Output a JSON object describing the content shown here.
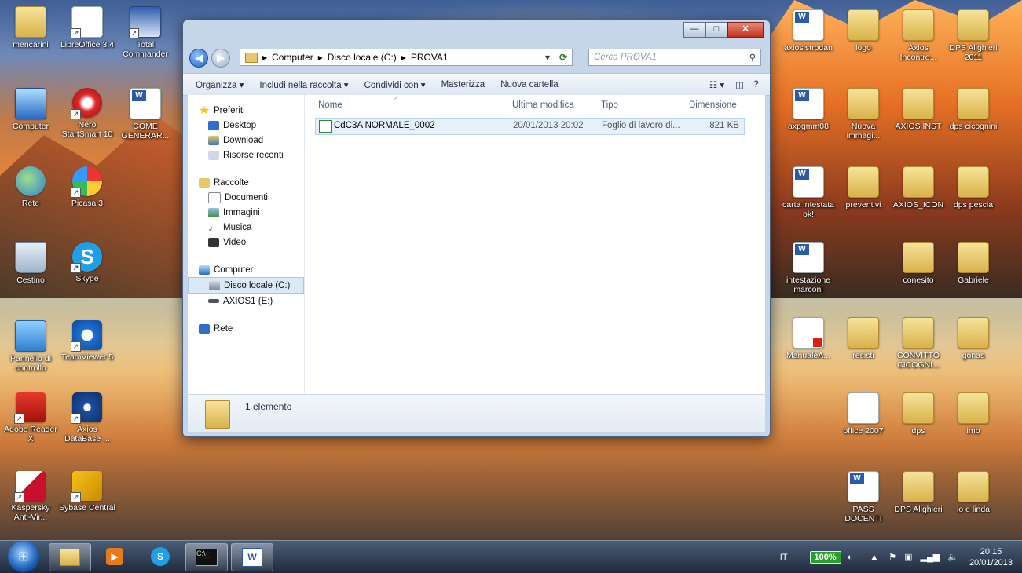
{
  "desktop": {
    "icons": [
      {
        "label": "mencarini"
      },
      {
        "label": "LibreOffice 3.4"
      },
      {
        "label": "Total Commander"
      },
      {
        "label": "Computer"
      },
      {
        "label": "Nero StartSmart 10"
      },
      {
        "label": "COME GENERAR..."
      },
      {
        "label": "Rete"
      },
      {
        "label": "Picasa 3"
      },
      {
        "label": "Cestino"
      },
      {
        "label": "Skype"
      },
      {
        "label": "Pannello di controllo"
      },
      {
        "label": "TeamViewer 5"
      },
      {
        "label": "Adobe Reader X"
      },
      {
        "label": "Axios DataBase ..."
      },
      {
        "label": "Kaspersky Anti-Vir..."
      },
      {
        "label": "Sybase Central"
      },
      {
        "label": "axiosistrodan"
      },
      {
        "label": "logo"
      },
      {
        "label": "Axios Incontro..."
      },
      {
        "label": "DPS Alighieri 2011"
      },
      {
        "label": "axpgmm08"
      },
      {
        "label": "Nuova immagi..."
      },
      {
        "label": "AXIOS INST"
      },
      {
        "label": "dps cicognini"
      },
      {
        "label": "carta intestata ok!"
      },
      {
        "label": "preventivi"
      },
      {
        "label": "AXIOS_ICON"
      },
      {
        "label": "dps pescia"
      },
      {
        "label": "intestazione marconi"
      },
      {
        "label": "conesito"
      },
      {
        "label": "Gabriele"
      },
      {
        "label": "ManualeA..."
      },
      {
        "label": "resisti"
      },
      {
        "label": "CONVITTO CICOGNI..."
      },
      {
        "label": "gonas"
      },
      {
        "label": "office 2007"
      },
      {
        "label": "dps"
      },
      {
        "label": "imb"
      },
      {
        "label": "PASS DOCENTI"
      },
      {
        "label": "DPS Alighieri"
      },
      {
        "label": "io e linda"
      }
    ]
  },
  "explorer": {
    "breadcrumb": [
      "Computer",
      "Disco locale (C:)",
      "PROVA1"
    ],
    "search_placeholder": "Cerca PROVA1",
    "toolbar": {
      "organize": "Organizza ▾",
      "include": "Includi nella raccolta ▾",
      "share": "Condividi con ▾",
      "burn": "Masterizza",
      "new_folder": "Nuova cartella"
    },
    "nav": {
      "favorites": "Preferiti",
      "fav_items": [
        "Desktop",
        "Download",
        "Risorse recenti"
      ],
      "libraries": "Raccolte",
      "lib_items": [
        "Documenti",
        "Immagini",
        "Musica",
        "Video"
      ],
      "computer": "Computer",
      "comp_items": [
        "Disco locale (C:)",
        "AXIOS1 (E:)"
      ],
      "network": "Rete"
    },
    "columns": {
      "name": "Nome",
      "modified": "Ultima modifica",
      "type": "Tipo",
      "size": "Dimensione"
    },
    "files": [
      {
        "name": "CdC3A NORMALE_0002",
        "modified": "20/01/2013 20:02",
        "type": "Foglio di lavoro di...",
        "size": "821 KB"
      }
    ],
    "status": "1 elemento"
  },
  "taskbar": {
    "language": "IT",
    "battery": "100%",
    "time": "20:15",
    "date": "20/01/2013"
  },
  "colors": {
    "accent": "#2b5aa8",
    "folder": "#e8c766",
    "taskbar": "#1f2a3c"
  }
}
